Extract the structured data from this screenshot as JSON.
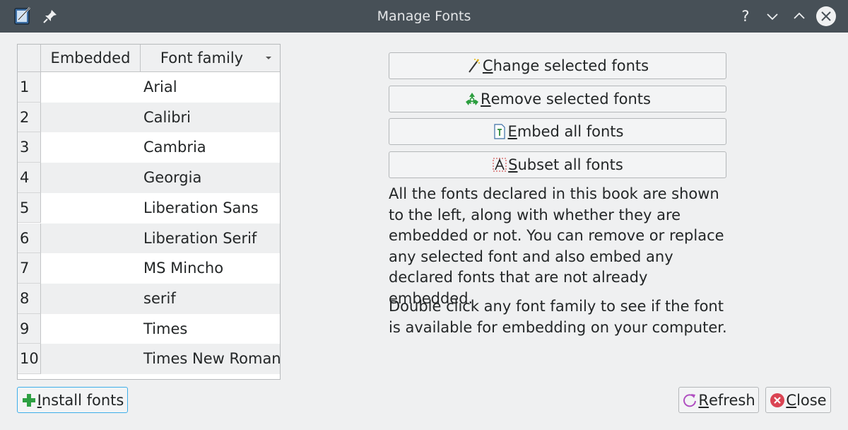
{
  "window": {
    "title": "Manage Fonts",
    "controls": {
      "help": "?",
      "minimize": "⌄",
      "maximize": "⌃"
    }
  },
  "table": {
    "headers": {
      "embedded": "Embedded",
      "font_family": "Font family"
    },
    "rows": [
      {
        "num": "1",
        "font": "Arial"
      },
      {
        "num": "2",
        "font": "Calibri"
      },
      {
        "num": "3",
        "font": "Cambria"
      },
      {
        "num": "4",
        "font": "Georgia"
      },
      {
        "num": "5",
        "font": "Liberation Sans"
      },
      {
        "num": "6",
        "font": "Liberation Serif"
      },
      {
        "num": "7",
        "font": "MS Mincho"
      },
      {
        "num": "8",
        "font": "serif"
      },
      {
        "num": "9",
        "font": "Times"
      },
      {
        "num": "10",
        "font": "Times New Roman"
      }
    ]
  },
  "actions": {
    "change": {
      "mnemonic": "C",
      "rest": "hange selected fonts",
      "icon": "magic-wand-icon"
    },
    "remove": {
      "mnemonic": "R",
      "rest": "emove selected fonts",
      "icon": "recycle-icon"
    },
    "embed": {
      "mnemonic": "E",
      "rest": "mbed all fonts",
      "icon": "font-file-icon"
    },
    "subset": {
      "mnemonic": "S",
      "rest": "ubset all fonts",
      "icon": "subset-font-icon"
    }
  },
  "description": {
    "paragraph1": "All the fonts declared in this book are shown to the left, along with whether they are embedded or not. You can remove or replace any selected font and also embed any declared fonts that are not already embedded.",
    "paragraph2": "Double click any font family to see if the font is available for embedding on your computer."
  },
  "footer": {
    "install": {
      "mnemonic": "I",
      "rest": "nstall fonts"
    },
    "refresh": {
      "mnemonic": "R",
      "rest": "efresh"
    },
    "close": {
      "mnemonic": "C",
      "rest": "lose"
    }
  },
  "colors": {
    "titlebar": "#475057",
    "focus_border": "#3daee9",
    "add_green": "#2ea043",
    "close_red": "#da4453",
    "refresh_magenta": "#b04fc1",
    "recycle_green": "#2b9e3e"
  }
}
